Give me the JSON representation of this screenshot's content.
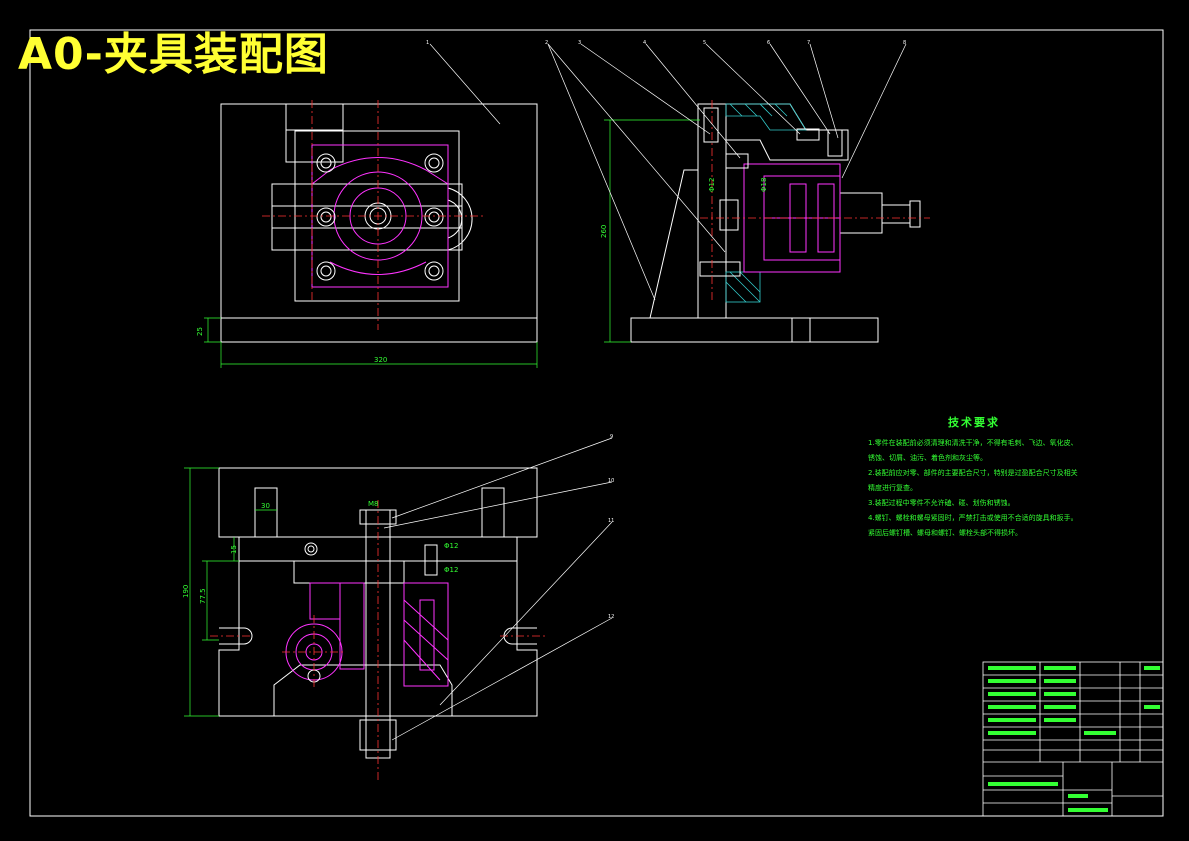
{
  "title": "A0-夹具装配图",
  "technical_requirements": {
    "heading": "技术要求",
    "items": [
      "1.零件在装配前必须清理和清洗干净，不得有毛刺、飞边、氧化皮、",
      "锈蚀、切屑、油污、着色剂和灰尘等。",
      "2.装配前应对零、部件的主要配合尺寸，特别是过盈配合尺寸及相关",
      "精度进行复查。",
      "3.装配过程中零件不允许磕、碰、划伤和锈蚀。",
      "4.螺钉、螺栓和螺母紧固时，严禁打击或使用不合适的旋具和扳手。",
      "紧固后螺钉槽、螺母和螺钉、螺栓头部不得损坏。"
    ]
  },
  "balloons": [
    "1",
    "2",
    "3",
    "4",
    "5",
    "6",
    "7",
    "8",
    "9",
    "10",
    "11",
    "12"
  ],
  "dimensions": {
    "front_width": "320",
    "front_base": "25",
    "side_height": "260",
    "side_dia1": "Φ12",
    "side_dia2": "Φ18",
    "bottom_height": "190",
    "bottom_sub": "77.5",
    "bottom_top": "15",
    "bottom_slot": "30",
    "bottom_thread": "M8",
    "bottom_dia1": "Φ12",
    "bottom_dia2": "Φ12"
  },
  "colors": {
    "background": "#000000",
    "outline": "#ffffff",
    "part": "#ff33ff",
    "dimension": "#33ff33",
    "center": "#ff3333",
    "title": "#ffff33",
    "hatch": "#33cccc"
  }
}
